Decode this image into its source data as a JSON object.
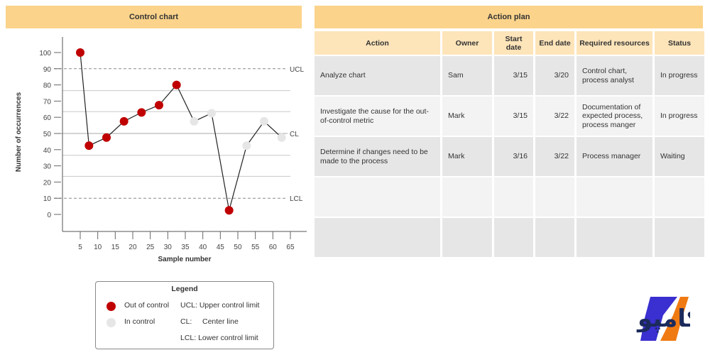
{
  "chart_title": "Control chart",
  "chart_data": {
    "type": "scatter",
    "title": "Control chart",
    "xlabel": "Sample number",
    "ylabel": "Number of occurrences",
    "xlim": [
      0,
      70
    ],
    "ylim": [
      -12,
      110
    ],
    "x_ticks": [
      5,
      10,
      15,
      20,
      25,
      30,
      35,
      40,
      45,
      50,
      55,
      60,
      65
    ],
    "y_ticks": [
      0,
      10,
      20,
      30,
      40,
      50,
      60,
      70,
      80,
      90,
      100
    ],
    "control_lines": [
      {
        "label": "UCL",
        "value": 90,
        "style": "dashed"
      },
      {
        "label": "CL",
        "value": 50,
        "style": "solid"
      },
      {
        "label": "LCL",
        "value": 10,
        "style": "dashed"
      }
    ],
    "zone_lines": [
      76.5,
      63.5,
      36.5,
      23.5
    ],
    "points": [
      {
        "x": 5,
        "y": 100,
        "status": "out"
      },
      {
        "x": 7.5,
        "y": 42.5,
        "status": "out"
      },
      {
        "x": 12.5,
        "y": 47.5,
        "status": "out"
      },
      {
        "x": 17.5,
        "y": 57.5,
        "status": "out"
      },
      {
        "x": 22.5,
        "y": 63,
        "status": "out"
      },
      {
        "x": 27.5,
        "y": 67.5,
        "status": "out"
      },
      {
        "x": 32.5,
        "y": 80,
        "status": "out"
      },
      {
        "x": 37.5,
        "y": 57.5,
        "status": "in"
      },
      {
        "x": 42.5,
        "y": 62.5,
        "status": "in"
      },
      {
        "x": 47.5,
        "y": 2.5,
        "status": "out"
      },
      {
        "x": 52.5,
        "y": 42.5,
        "status": "in"
      },
      {
        "x": 57.5,
        "y": 57.5,
        "status": "in"
      },
      {
        "x": 62.5,
        "y": 47.5,
        "status": "in"
      }
    ],
    "colors": {
      "out": "#c00000",
      "in": "#e6e6e6"
    },
    "grid": false
  },
  "legend": {
    "title": "Legend",
    "out_label": "Out of control",
    "in_label": "In control",
    "ucl": "UCL: Upper control limit",
    "cl_key": "CL:",
    "cl_text": "Center line",
    "lcl": "LCL: Lower control limit"
  },
  "plan": {
    "title": "Action plan",
    "headers": [
      "Action",
      "Owner",
      "Start date",
      "End date",
      "Required resources",
      "Status"
    ],
    "rows": [
      [
        "Analyze chart",
        "Sam",
        "3/15",
        "3/20",
        "Control chart, process analyst",
        "In progress"
      ],
      [
        "Investigate the cause for the out-of-control metric",
        "Mark",
        "3/15",
        "3/22",
        "Documentation of expected process, process manger",
        "In progress"
      ],
      [
        "Determine if changes need to be made to the process",
        "Mark",
        "3/16",
        "3/22",
        "Process manager",
        "Waiting"
      ],
      [
        "",
        "",
        "",
        "",
        "",
        ""
      ],
      [
        "",
        "",
        "",
        "",
        "",
        ""
      ]
    ]
  },
  "logo": {
    "text": "ایران کامپو",
    "colors": [
      "#3a2fd0",
      "#f07a12",
      "#1b2a5c"
    ]
  }
}
